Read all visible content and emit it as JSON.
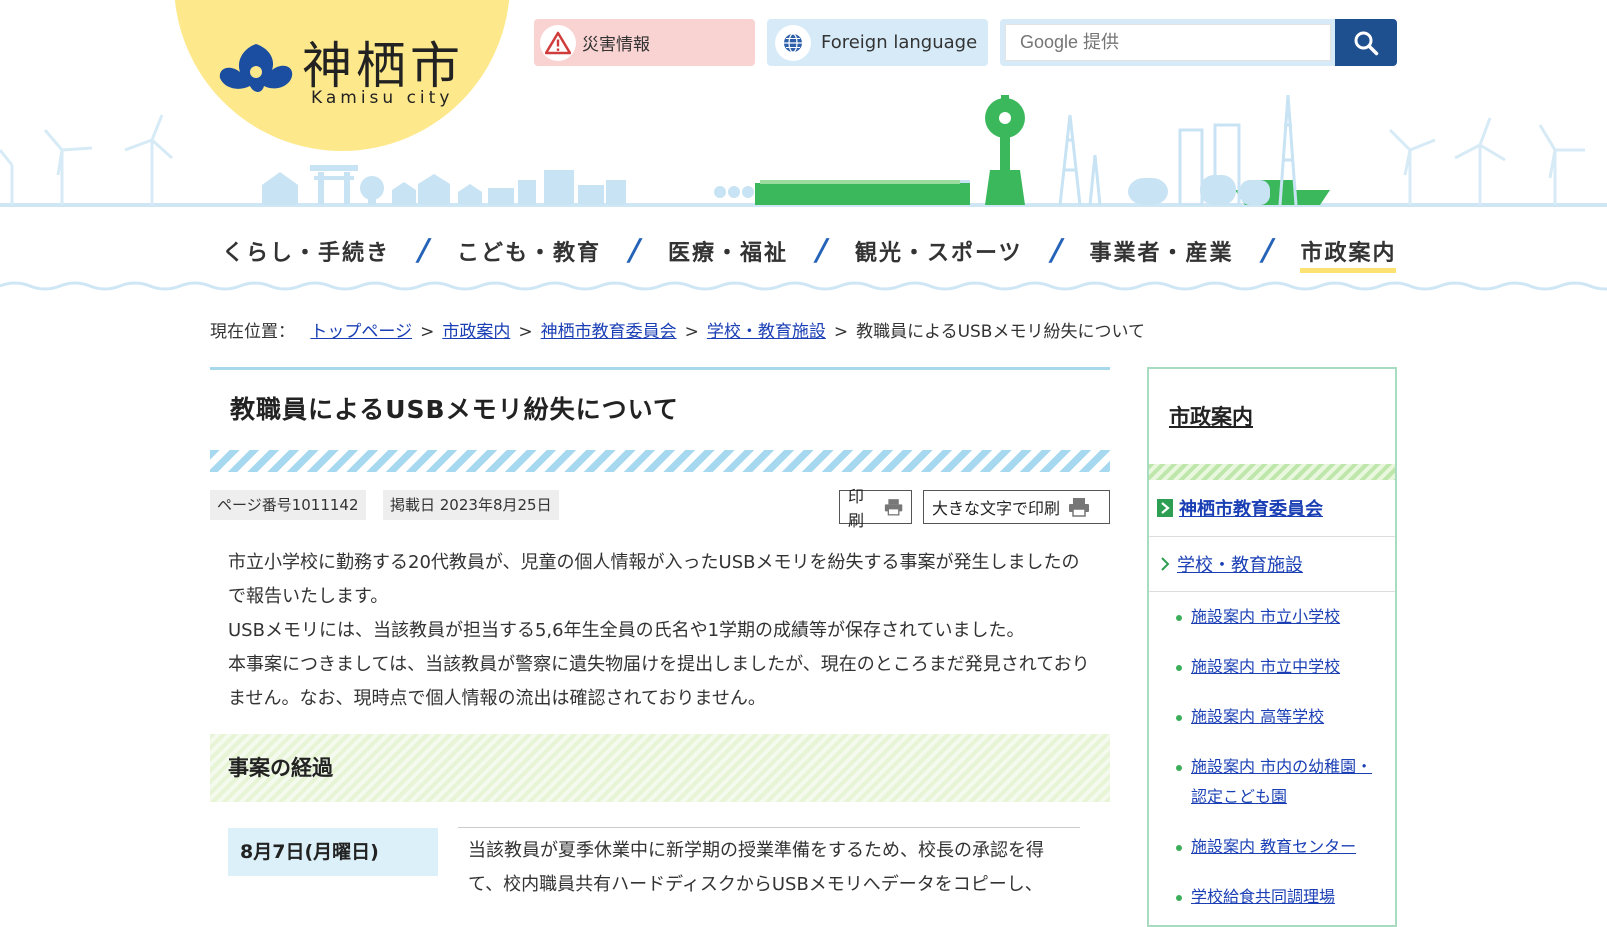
{
  "header": {
    "logo_kanji": "神栖市",
    "logo_roman": "Kamisu city",
    "disaster_label": "災害情報",
    "foreign_label": "Foreign language",
    "search_placeholder": "Google 提供"
  },
  "nav": {
    "items": [
      {
        "label": "くらし・手続き"
      },
      {
        "label": "こども・教育"
      },
      {
        "label": "医療・福祉"
      },
      {
        "label": "観光・スポーツ"
      },
      {
        "label": "事業者・産業"
      },
      {
        "label": "市政案内"
      }
    ]
  },
  "breadcrumb": {
    "prefix": "現在位置：",
    "links": [
      "トップページ",
      "市政案内",
      "神栖市教育委員会",
      "学校・教育施設"
    ],
    "current": "教職員によるUSBメモリ紛失について"
  },
  "article": {
    "title": "教職員によるUSBメモリ紛失について",
    "page_number": "ページ番号1011142",
    "posted_date": "掲載日 2023年8月25日",
    "print_label": "印刷",
    "print_large_label": "大きな文字で印刷",
    "paragraphs": [
      "市立小学校に勤務する20代教員が、児童の個人情報が入ったUSBメモリを紛失する事案が発生しましたので報告いたします。",
      "USBメモリには、当該教員が担当する5,6年生全員の氏名や1学期の成績等が保存されていました。",
      "本事案につきましては、当該教員が警察に遺失物届けを提出しましたが、現在のところまだ発見されておりません。なお、現時点で個人情報の流出は確認されておりません。"
    ],
    "section_heading": "事案の経過",
    "timeline": [
      {
        "date": "8月7日(月曜日)",
        "text": "当該教員が夏季休業中に新学期の授業準備をするため、校長の承認を得て、校内職員共有ハードディスクからUSBメモリへデータをコピーし、"
      }
    ]
  },
  "sidebar": {
    "heading": "市政案内",
    "current": "神栖市教育委員会",
    "sub": "学校・教育施設",
    "links": [
      "施設案内 市立小学校",
      "施設案内 市立中学校",
      "施設案内 高等学校",
      "施設案内 市内の幼稚園・認定こども園",
      "施設案内 教育センター",
      "学校給食共同調理場"
    ]
  },
  "colors": {
    "accent_blue": "#1e4f8e",
    "link": "#1a3fb5",
    "logo_yellow": "#fde98c",
    "skyline_blue": "#c8e3f4",
    "skyline_green": "#3cb85c"
  }
}
